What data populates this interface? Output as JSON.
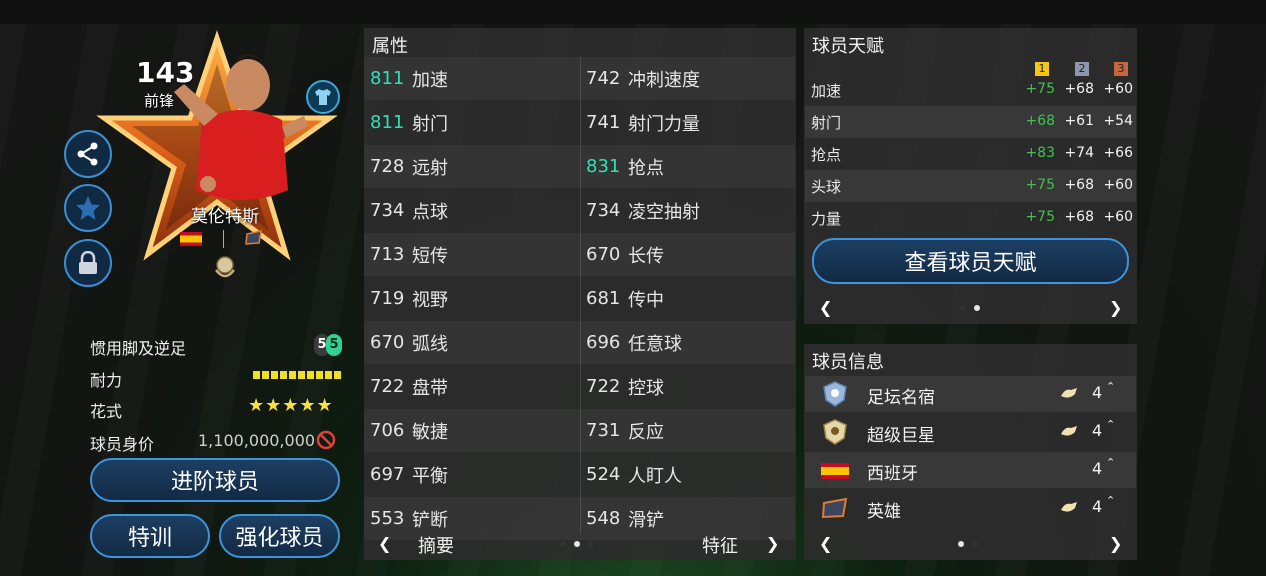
{
  "player": {
    "rating": "143",
    "position": "前锋",
    "name": "莫伦特斯"
  },
  "left_stats": {
    "foot_label": "惯用脚及逆足",
    "foot_strong": "5",
    "foot_weak": "5",
    "stamina_label": "耐力",
    "skill_label": "花式",
    "skill_stars": "★★★★★",
    "value_label": "球员身价",
    "value": "1,100,000,000"
  },
  "buttons": {
    "advance": "进阶球员",
    "train": "特训",
    "enhance": "强化球员",
    "view_talent": "查看球员天赋"
  },
  "attributes": {
    "title": "属性",
    "rows": [
      {
        "l_val": "811",
        "l_name": "加速",
        "l_hi": true,
        "r_val": "742",
        "r_name": "冲刺速度",
        "r_hi": false
      },
      {
        "l_val": "811",
        "l_name": "射门",
        "l_hi": true,
        "r_val": "741",
        "r_name": "射门力量",
        "r_hi": false
      },
      {
        "l_val": "728",
        "l_name": "远射",
        "l_hi": false,
        "r_val": "831",
        "r_name": "抢点",
        "r_hi": true
      },
      {
        "l_val": "734",
        "l_name": "点球",
        "l_hi": false,
        "r_val": "734",
        "r_name": "凌空抽射",
        "r_hi": false
      },
      {
        "l_val": "713",
        "l_name": "短传",
        "l_hi": false,
        "r_val": "670",
        "r_name": "长传",
        "r_hi": false
      },
      {
        "l_val": "719",
        "l_name": "视野",
        "l_hi": false,
        "r_val": "681",
        "r_name": "传中",
        "r_hi": false
      },
      {
        "l_val": "670",
        "l_name": "弧线",
        "l_hi": false,
        "r_val": "696",
        "r_name": "任意球",
        "r_hi": false
      },
      {
        "l_val": "722",
        "l_name": "盘带",
        "l_hi": false,
        "r_val": "722",
        "r_name": "控球",
        "r_hi": false
      },
      {
        "l_val": "706",
        "l_name": "敏捷",
        "l_hi": false,
        "r_val": "731",
        "r_name": "反应",
        "r_hi": false
      },
      {
        "l_val": "697",
        "l_name": "平衡",
        "l_hi": false,
        "r_val": "524",
        "r_name": "人盯人",
        "r_hi": false
      },
      {
        "l_val": "553",
        "l_name": "铲断",
        "l_hi": false,
        "r_val": "548",
        "r_name": "滑铲",
        "r_hi": false
      }
    ],
    "nav_left": "摘要",
    "nav_right": "特征",
    "arrow_left": "❮",
    "arrow_right": "❯"
  },
  "talent": {
    "title": "球员天赋",
    "tiers": [
      "1",
      "2",
      "3"
    ],
    "tier_colors": [
      "#f5c518",
      "#8a98b0",
      "#c7663a"
    ],
    "rows": [
      {
        "name": "加速",
        "v1": "+75",
        "v2": "+68",
        "v3": "+60"
      },
      {
        "name": "射门",
        "v1": "+68",
        "v2": "+61",
        "v3": "+54"
      },
      {
        "name": "抢点",
        "v1": "+83",
        "v2": "+74",
        "v3": "+66"
      },
      {
        "name": "头球",
        "v1": "+75",
        "v2": "+68",
        "v3": "+60"
      },
      {
        "name": "力量",
        "v1": "+75",
        "v2": "+68",
        "v3": "+60"
      }
    ],
    "arrow_left": "❮",
    "arrow_right": "❯"
  },
  "info": {
    "title": "球员信息",
    "rows": [
      {
        "label": "足坛名宿",
        "level": "4",
        "icon": "legend-badge-icon",
        "cap": true
      },
      {
        "label": "超级巨星",
        "level": "4",
        "icon": "superstar-badge-icon",
        "cap": true
      },
      {
        "label": "西班牙",
        "level": "4",
        "icon": "spain-flag-icon",
        "cap": false
      },
      {
        "label": "英雄",
        "level": "4",
        "icon": "hero-badge-icon",
        "cap": true
      }
    ],
    "arrow_left": "❮",
    "arrow_right": "❯"
  },
  "colors": {
    "accent_blue": "#3e94d9",
    "highlight_teal": "#2ee0b7",
    "talent_green": "#3fc24e",
    "star_orange": "#f28a1a"
  }
}
